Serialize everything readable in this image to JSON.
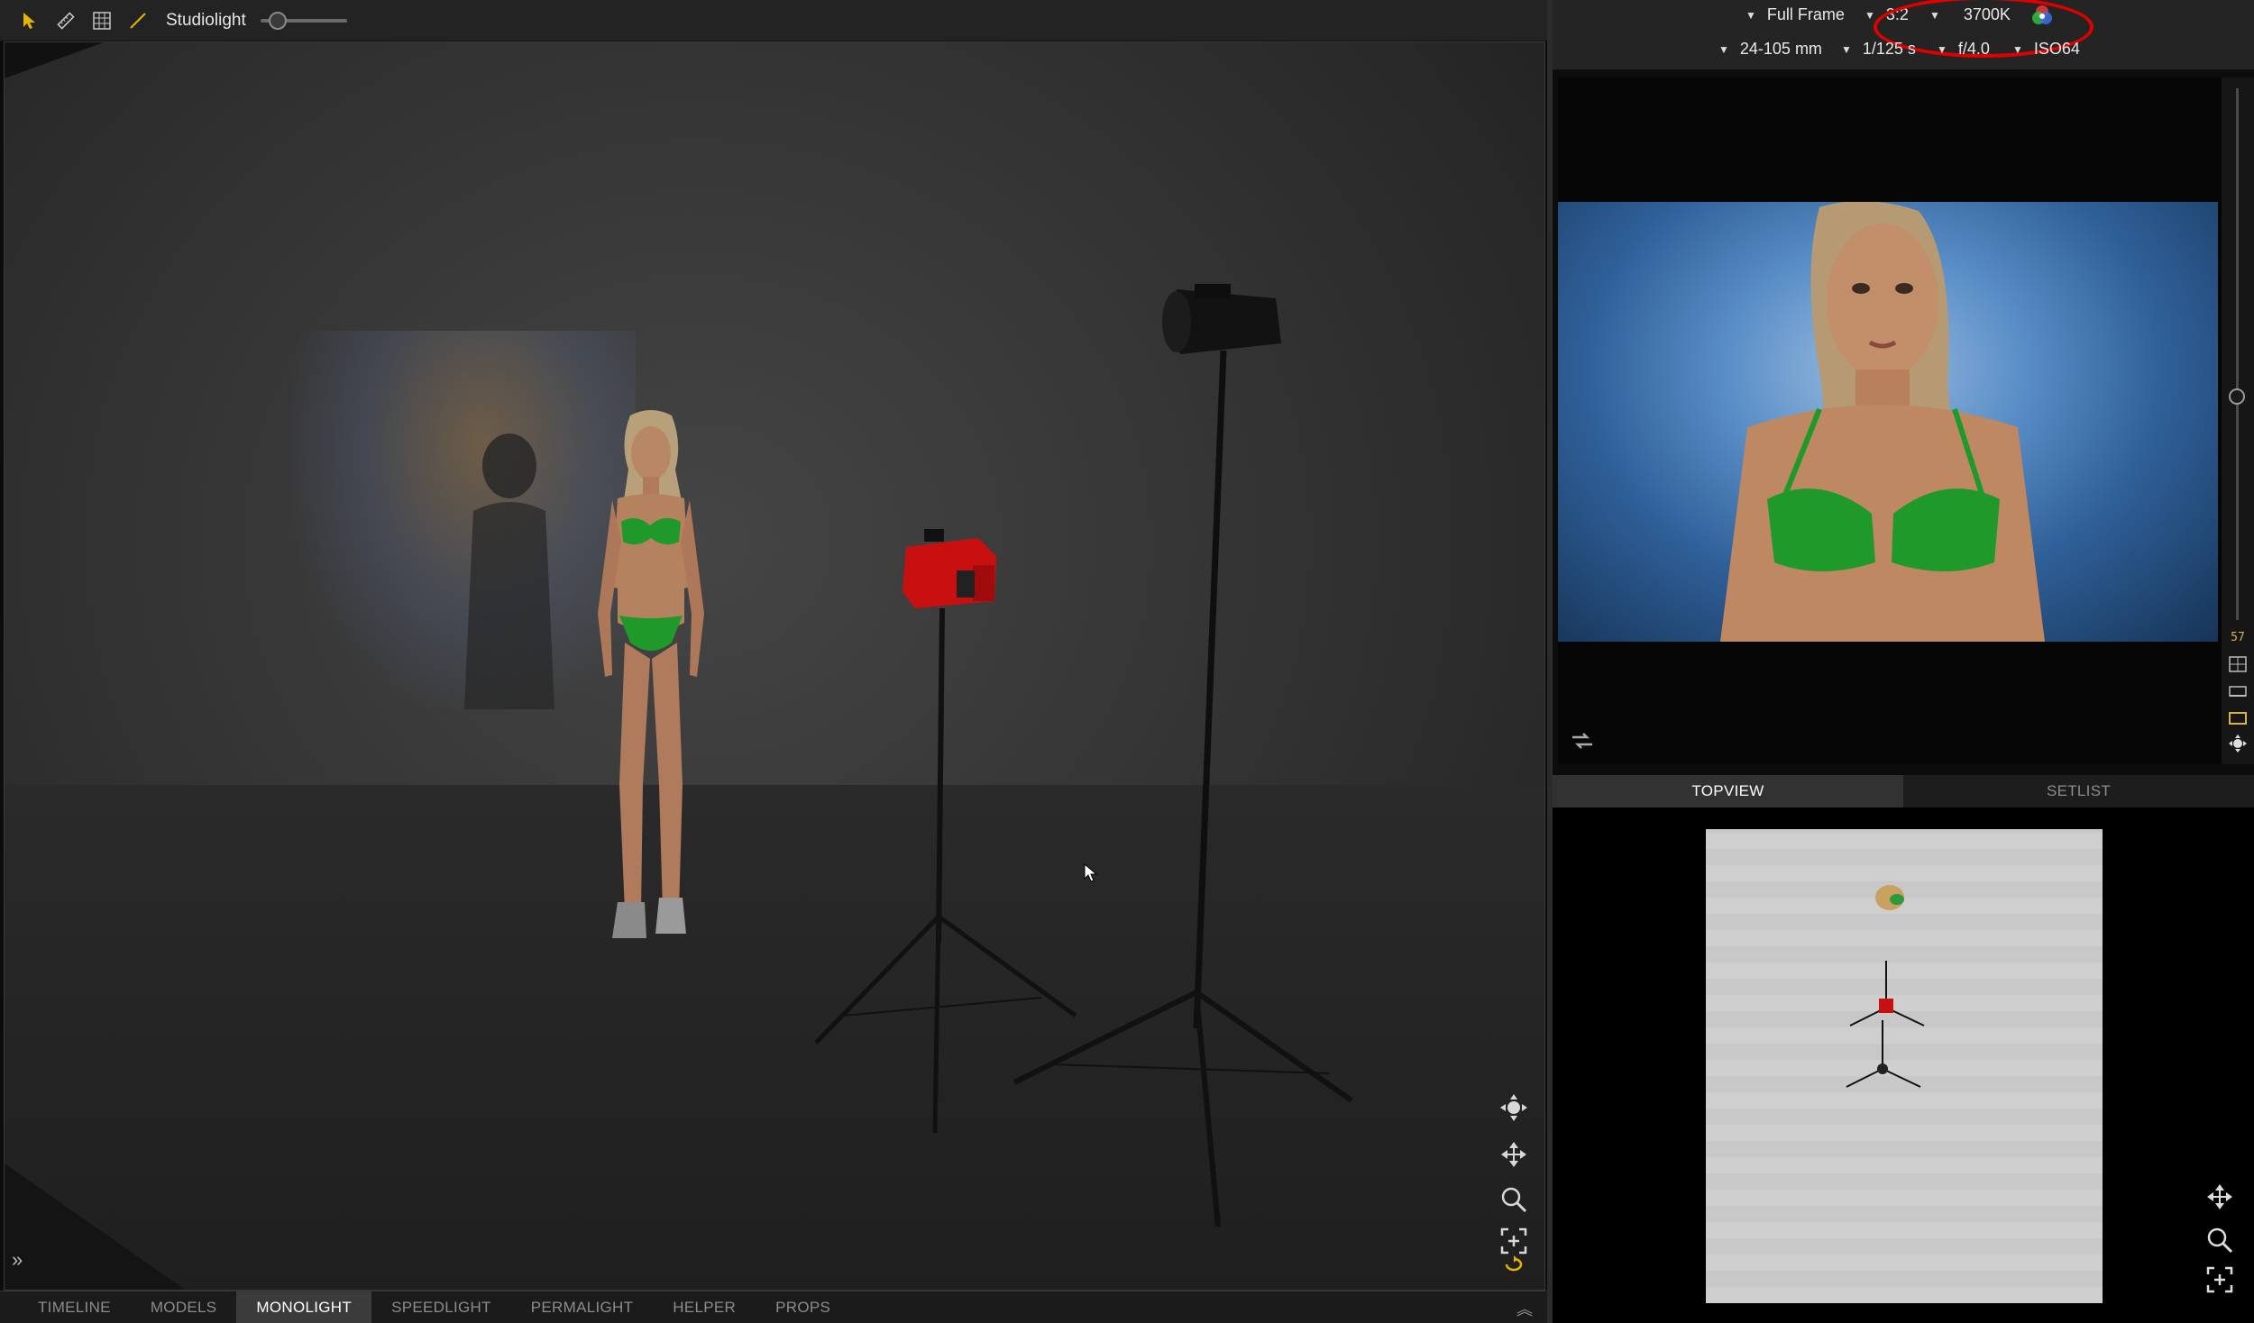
{
  "toolbar": {
    "mode_label": "Studiolight",
    "slider_value": 0.2,
    "icons": [
      "pointer-icon",
      "ruler-icon",
      "grid-icon",
      "line-icon"
    ]
  },
  "viewport": {
    "nav_icons": [
      "orbit-icon",
      "pan-icon",
      "zoom-icon",
      "fit-view-icon",
      "reset-view-icon"
    ],
    "expand_glyph": "»"
  },
  "bottom_tabs": {
    "items": [
      {
        "label": "TIMELINE",
        "active": false
      },
      {
        "label": "MODELS",
        "active": false
      },
      {
        "label": "MONOLIGHT",
        "active": true
      },
      {
        "label": "SPEEDLIGHT",
        "active": false
      },
      {
        "label": "PERMALIGHT",
        "active": false
      },
      {
        "label": "HELPER",
        "active": false
      },
      {
        "label": "PROPS",
        "active": false
      }
    ],
    "collapse_glyph": "︽"
  },
  "camera": {
    "sensor": "Full Frame",
    "aspect": "3:2",
    "white_balance": "3700K",
    "lens": "24-105 mm",
    "shutter": "1/125 s",
    "aperture": "f/4.0",
    "iso": "ISO64",
    "highlight_color": "#e00000"
  },
  "preview": {
    "side_badge": "57",
    "slider_value": 0.58
  },
  "topview_tabs": {
    "items": [
      {
        "label": "TOPVIEW",
        "active": true
      },
      {
        "label": "SETLIST",
        "active": false
      }
    ]
  },
  "colors": {
    "accent_yellow": "#d8b24a",
    "bikini_green": "#1f9a2a",
    "camera_red": "#c81010"
  }
}
